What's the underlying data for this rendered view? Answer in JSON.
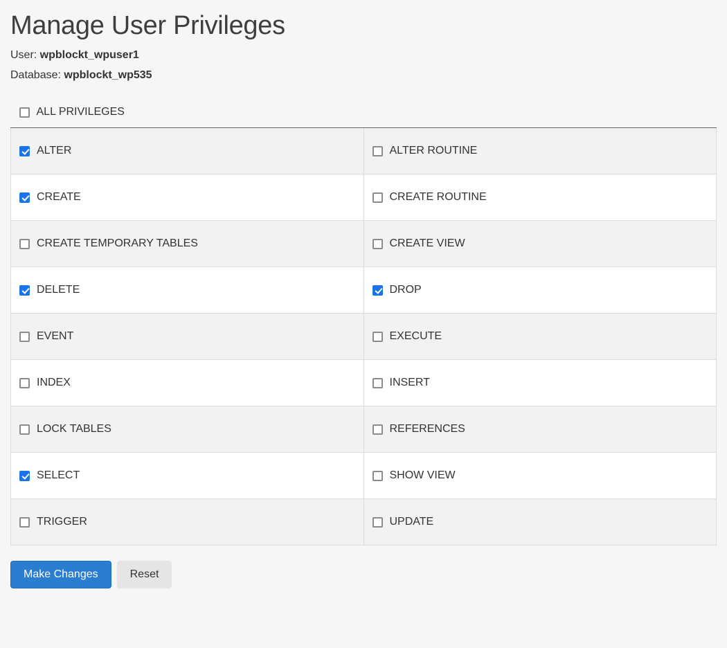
{
  "title": "Manage User Privileges",
  "user_label": "User: ",
  "user_value": "wpblockt_wpuser1",
  "db_label": "Database: ",
  "db_value": "wpblockt_wp535",
  "all_privileges": {
    "label": "ALL PRIVILEGES",
    "checked": false
  },
  "privileges": [
    {
      "left": {
        "label": "ALTER",
        "checked": true
      },
      "right": {
        "label": "ALTER ROUTINE",
        "checked": false
      }
    },
    {
      "left": {
        "label": "CREATE",
        "checked": true
      },
      "right": {
        "label": "CREATE ROUTINE",
        "checked": false
      }
    },
    {
      "left": {
        "label": "CREATE TEMPORARY TABLES",
        "checked": false
      },
      "right": {
        "label": "CREATE VIEW",
        "checked": false
      }
    },
    {
      "left": {
        "label": "DELETE",
        "checked": true
      },
      "right": {
        "label": "DROP",
        "checked": true
      }
    },
    {
      "left": {
        "label": "EVENT",
        "checked": false
      },
      "right": {
        "label": "EXECUTE",
        "checked": false
      }
    },
    {
      "left": {
        "label": "INDEX",
        "checked": false
      },
      "right": {
        "label": "INSERT",
        "checked": false
      }
    },
    {
      "left": {
        "label": "LOCK TABLES",
        "checked": false
      },
      "right": {
        "label": "REFERENCES",
        "checked": false
      }
    },
    {
      "left": {
        "label": "SELECT",
        "checked": true
      },
      "right": {
        "label": "SHOW VIEW",
        "checked": false
      }
    },
    {
      "left": {
        "label": "TRIGGER",
        "checked": false
      },
      "right": {
        "label": "UPDATE",
        "checked": false
      }
    }
  ],
  "buttons": {
    "submit": "Make Changes",
    "reset": "Reset"
  }
}
